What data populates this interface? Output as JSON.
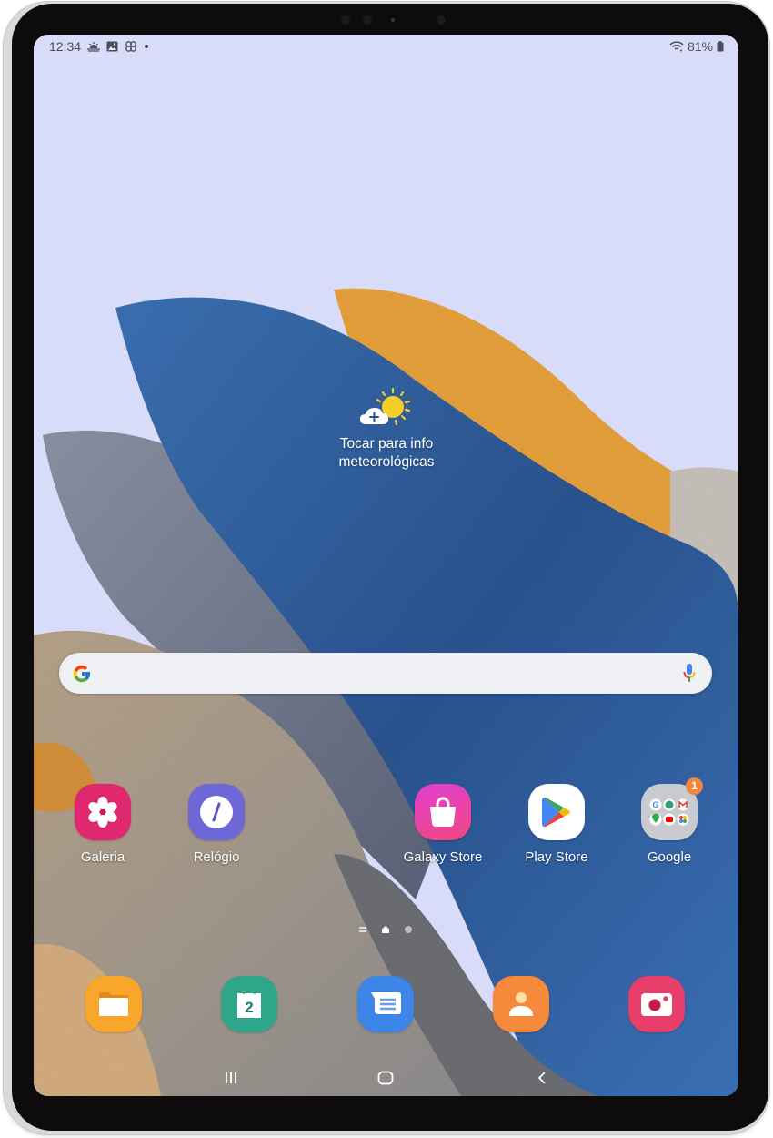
{
  "status_bar": {
    "time": "12:34",
    "notification_icons": [
      "weather-icon",
      "gallery-icon",
      "pinwheel-icon",
      "dot-icon"
    ],
    "battery_percent": "81%",
    "right_icons": [
      "wifi-icon",
      "battery-icon"
    ]
  },
  "weather_widget": {
    "icon": "partly-sunny-add-icon",
    "line1": "Tocar para info",
    "line2": "meteorológicas"
  },
  "search": {
    "placeholder": "",
    "value": "",
    "left_icon": "google-g-icon",
    "right_icon": "microphone-icon"
  },
  "apps": [
    {
      "label": "Galeria",
      "icon": "gallery-flower-icon",
      "color": "#e0286f"
    },
    {
      "label": "Relógio",
      "icon": "clock-icon",
      "color": "#6d67d8"
    },
    {
      "label": "Galaxy Store",
      "icon": "shopping-bag-icon",
      "color": "#e73fc3"
    },
    {
      "label": "Play Store",
      "icon": "play-store-icon",
      "color": "#ffffff"
    },
    {
      "label": "Google",
      "icon": "google-folder-icon",
      "color": "#c9cbd0",
      "badge": "1"
    }
  ],
  "page_indicator": {
    "pages": 3,
    "current": 2
  },
  "dock": [
    {
      "name": "my-files",
      "icon": "folder-icon",
      "color": "#f9a72b"
    },
    {
      "name": "calendar",
      "icon": "calendar-icon",
      "color": "#2fa58a",
      "day": "2"
    },
    {
      "name": "messages",
      "icon": "message-icon",
      "color": "#3d86e8"
    },
    {
      "name": "contacts",
      "icon": "contact-icon",
      "color": "#f6893b"
    },
    {
      "name": "camera",
      "icon": "camera-icon",
      "color": "#e83f6a"
    }
  ],
  "nav_bar": {
    "buttons": [
      "recents-icon",
      "home-icon",
      "back-icon"
    ]
  }
}
